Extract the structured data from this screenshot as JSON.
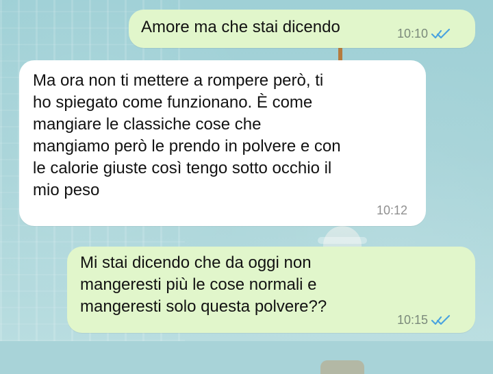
{
  "messages": [
    {
      "direction": "outgoing",
      "text": "Amore ma che stai dicendo",
      "time": "10:10",
      "status": "read",
      "status_icon": "double-check-icon"
    },
    {
      "direction": "incoming",
      "text": "Ma ora non ti mettere a rompere però, ti\nho spiegato come funzionano. È come\nmangiare le classiche cose che\nmangiamo però le prendo in polvere e con\nle calorie giuste così tengo sotto occhio il\nmio peso",
      "time": "10:12"
    },
    {
      "direction": "outgoing",
      "text": "Mi stai dicendo che da oggi non\nmangeresti più le cose normali e\nmangeresti solo questa polvere??",
      "time": "10:15",
      "status": "read",
      "status_icon": "double-check-icon"
    }
  ],
  "colors": {
    "outgoing_bubble": "#e1f6cb",
    "incoming_bubble": "#ffffff",
    "read_ticks": "#4aa3df",
    "wallpaper": "#a8d3d8"
  }
}
